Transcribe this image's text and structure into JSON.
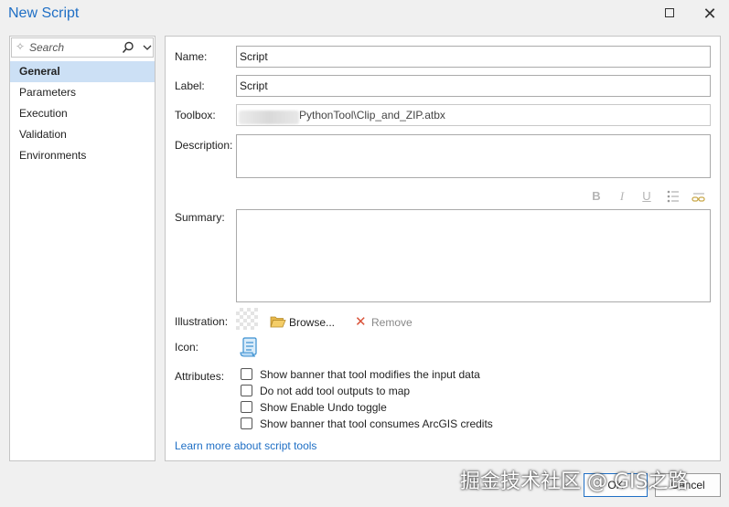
{
  "window": {
    "title": "New Script"
  },
  "search": {
    "placeholder": "Search"
  },
  "nav": {
    "items": [
      "General",
      "Parameters",
      "Execution",
      "Validation",
      "Environments"
    ],
    "active": "General"
  },
  "form": {
    "name_label": "Name:",
    "name_value": "Script",
    "label_label": "Label:",
    "label_value": "Script",
    "toolbox_label": "Toolbox:",
    "toolbox_value": "PythonTool\\Clip_and_ZIP.atbx",
    "description_label": "Description:",
    "summary_label": "Summary:",
    "format_buttons": [
      "B",
      "I",
      "U"
    ],
    "illustration_label": "Illustration:",
    "browse_label": "Browse...",
    "remove_label": "Remove",
    "icon_label": "Icon:",
    "attributes_label": "Attributes:",
    "attributes": [
      {
        "label": "Show banner that tool modifies the input data",
        "checked": false
      },
      {
        "label": "Do not add tool outputs to map",
        "checked": false
      },
      {
        "label": "Show Enable Undo toggle",
        "checked": false
      },
      {
        "label": "Show banner that tool consumes ArcGIS credits",
        "checked": false
      }
    ],
    "learn_more": "Learn more about script tools"
  },
  "footer": {
    "ok_label": "OK",
    "cancel_label": "Cancel"
  },
  "watermark": "掘金技术社区 @ GIS之路",
  "colors": {
    "accent": "#1f6fc5",
    "nav_active_bg": "#cce0f5",
    "remove_icon": "#d9533a"
  }
}
